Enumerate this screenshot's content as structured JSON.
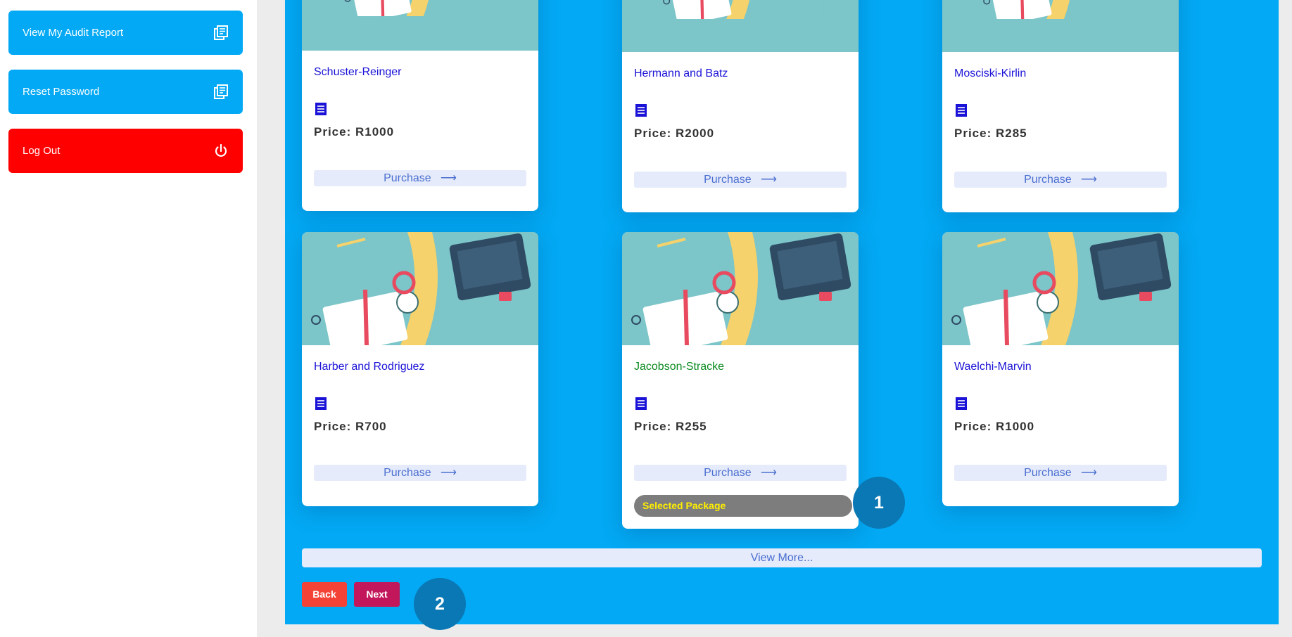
{
  "sidebar": {
    "items": [
      {
        "label": "View My Audit Report",
        "icon": "library-books-icon",
        "color": "#03a9f4"
      },
      {
        "label": "Reset Password",
        "icon": "library-books-icon",
        "color": "#03a9f4"
      },
      {
        "label": "Log Out",
        "icon": "power-icon",
        "color": "#ff0000"
      }
    ]
  },
  "cards": [
    {
      "name": "Schuster-Reinger",
      "price": "Price: R1000",
      "purchase": "Purchase",
      "arrow": "⟶"
    },
    {
      "name": "Hermann and Batz",
      "price": "Price: R2000",
      "purchase": "Purchase",
      "arrow": "⟶"
    },
    {
      "name": "Mosciski-Kirlin",
      "price": "Price: R285",
      "purchase": "Purchase",
      "arrow": "⟶"
    },
    {
      "name": "Harber and Rodriguez",
      "price": "Price: R700",
      "purchase": "Purchase",
      "arrow": "⟶"
    },
    {
      "name": "Jacobson-Stracke",
      "price": "Price: R255",
      "purchase": "Purchase",
      "arrow": "⟶",
      "selected_label": "Selected Package"
    },
    {
      "name": "Waelchi-Marvin",
      "price": "Price: R1000",
      "purchase": "Purchase",
      "arrow": "⟶"
    }
  ],
  "view_more": "View More...",
  "buttons": {
    "back": "Back",
    "next": "Next"
  },
  "markers": [
    "1",
    "2"
  ],
  "colors": {
    "accent": "#03a9f4",
    "logout": "#ff0000",
    "selected_name": "#0a8a1f",
    "selected_badge_text": "#ffee00"
  }
}
